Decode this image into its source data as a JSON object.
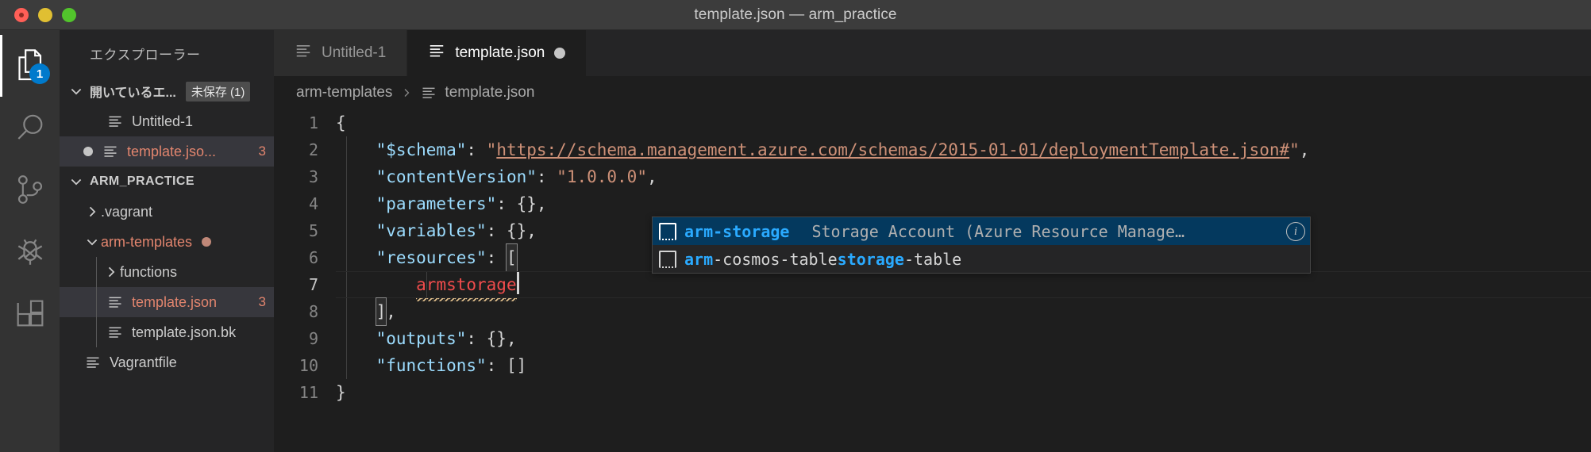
{
  "window": {
    "title": "template.json — arm_practice",
    "traffic_lights": [
      "close",
      "minimize",
      "zoom"
    ]
  },
  "activitybar": {
    "items": [
      {
        "name": "explorer",
        "icon": "files-icon",
        "active": true,
        "badge": "1"
      },
      {
        "name": "search",
        "icon": "search-icon",
        "active": false,
        "badge": ""
      },
      {
        "name": "source-control",
        "icon": "source-control-icon",
        "active": false,
        "badge": ""
      },
      {
        "name": "run-and-debug",
        "icon": "bug-icon",
        "active": false,
        "badge": ""
      },
      {
        "name": "extensions",
        "icon": "extensions-icon",
        "active": false,
        "badge": ""
      }
    ]
  },
  "sidebar": {
    "title": "エクスプローラー",
    "open_editors": {
      "header": "開いているエ...",
      "badge": "未保存 (1)",
      "items": [
        {
          "label": "Untitled-1",
          "icon": "json-file-icon",
          "dirty": false,
          "selected": false,
          "count": ""
        },
        {
          "label": "template.jso...",
          "icon": "json-file-icon",
          "dirty": true,
          "selected": true,
          "count": "3"
        }
      ]
    },
    "folder": {
      "header": "ARM_PRACTICE",
      "tree": [
        {
          "label": ".vagrant",
          "type": "folder",
          "expanded": false,
          "depth": 1,
          "modified": false,
          "count": "",
          "selected": false
        },
        {
          "label": "arm-templates",
          "type": "folder",
          "expanded": true,
          "depth": 1,
          "modified": true,
          "count": "",
          "selected": false,
          "dot": true
        },
        {
          "label": "functions",
          "type": "folder",
          "expanded": false,
          "depth": 2,
          "modified": false,
          "count": "",
          "selected": false
        },
        {
          "label": "template.json",
          "type": "file",
          "depth": 2,
          "modified": true,
          "count": "3",
          "selected": true
        },
        {
          "label": "template.json.bk",
          "type": "file",
          "depth": 2,
          "modified": false,
          "count": "",
          "selected": false
        },
        {
          "label": "Vagrantfile",
          "type": "file",
          "depth": 1,
          "modified": false,
          "count": "",
          "selected": false
        }
      ]
    }
  },
  "tabs": [
    {
      "label": "Untitled-1",
      "icon": "json-file-icon",
      "active": false,
      "dirty": false
    },
    {
      "label": "template.json",
      "icon": "json-file-icon",
      "active": true,
      "dirty": true
    }
  ],
  "breadcrumb": {
    "folder": "arm-templates",
    "separator": "›",
    "file": "template.json",
    "file_icon": "json-file-icon"
  },
  "editor": {
    "language": "json",
    "line_numbers": [
      "1",
      "2",
      "3",
      "4",
      "5",
      "6",
      "7",
      "8",
      "9",
      "10",
      "11"
    ],
    "current_line": 7,
    "lines": [
      {
        "n": "1",
        "tokens": [
          {
            "t": "{",
            "c": "p"
          }
        ]
      },
      {
        "n": "2",
        "tokens": [
          {
            "t": "    ",
            "c": "p"
          },
          {
            "t": "\"$schema\"",
            "c": "k"
          },
          {
            "t": ": ",
            "c": "p"
          },
          {
            "t": "\"",
            "c": "s"
          },
          {
            "t": "https://schema.management.azure.com/schemas/2015-01-01/deploymentTemplate.json#",
            "c": "lnk"
          },
          {
            "t": "\"",
            "c": "s"
          },
          {
            "t": ",",
            "c": "p"
          }
        ]
      },
      {
        "n": "3",
        "tokens": [
          {
            "t": "    ",
            "c": "p"
          },
          {
            "t": "\"contentVersion\"",
            "c": "k"
          },
          {
            "t": ": ",
            "c": "p"
          },
          {
            "t": "\"1.0.0.0\"",
            "c": "s"
          },
          {
            "t": ",",
            "c": "p"
          }
        ]
      },
      {
        "n": "4",
        "tokens": [
          {
            "t": "    ",
            "c": "p"
          },
          {
            "t": "\"parameters\"",
            "c": "k"
          },
          {
            "t": ": {},",
            "c": "p"
          }
        ]
      },
      {
        "n": "5",
        "tokens": [
          {
            "t": "    ",
            "c": "p"
          },
          {
            "t": "\"variables\"",
            "c": "k"
          },
          {
            "t": ": {},",
            "c": "p"
          }
        ]
      },
      {
        "n": "6",
        "tokens": [
          {
            "t": "    ",
            "c": "p"
          },
          {
            "t": "\"resources\"",
            "c": "k"
          },
          {
            "t": ": ",
            "c": "p"
          },
          {
            "t": "[",
            "c": "bracketmatch"
          }
        ]
      },
      {
        "n": "7",
        "tokens": [
          {
            "t": "        ",
            "c": "p"
          },
          {
            "t": "armstorage",
            "c": "err squiggle"
          }
        ]
      },
      {
        "n": "8",
        "tokens": [
          {
            "t": "    ",
            "c": "p"
          },
          {
            "t": "]",
            "c": "bracketmatch"
          },
          {
            "t": ",",
            "c": "p"
          }
        ]
      },
      {
        "n": "9",
        "tokens": [
          {
            "t": "    ",
            "c": "p"
          },
          {
            "t": "\"outputs\"",
            "c": "k"
          },
          {
            "t": ": {},",
            "c": "p"
          }
        ]
      },
      {
        "n": "10",
        "tokens": [
          {
            "t": "    ",
            "c": "p"
          },
          {
            "t": "\"functions\"",
            "c": "k"
          },
          {
            "t": ": []",
            "c": "p"
          }
        ]
      },
      {
        "n": "11",
        "tokens": [
          {
            "t": "}",
            "c": "p"
          }
        ]
      }
    ],
    "raw_text": "{\n    \"$schema\": \"https://schema.management.azure.com/schemas/2015-01-01/deploymentTemplate.json#\",\n    \"contentVersion\": \"1.0.0.0\",\n    \"parameters\": {},\n    \"variables\": {},\n    \"resources\": [\n        armstorage\n    ],\n    \"outputs\": {},\n    \"functions\": []\n}"
  },
  "suggest_widget": {
    "items": [
      {
        "icon": "snippet-icon",
        "label_pre": "arm",
        "label_match": "-storage",
        "label_post": "",
        "detail": "Storage Account (Azure Resource Manage…",
        "info_icon": "info-icon",
        "focused": true
      },
      {
        "icon": "snippet-icon",
        "label_pre": "arm",
        "label_mid": "-cosmos-table",
        "label_match": "storage",
        "label_post": "-table",
        "detail": "",
        "info_icon": "",
        "focused": false
      }
    ]
  },
  "colors": {
    "titlebar": "#3c3c3c",
    "activitybar": "#333333",
    "sidebar": "#252526",
    "editor": "#1e1e1e",
    "accent_blue": "#007acc",
    "suggest_focus": "#04395e",
    "string": "#ce9178",
    "key": "#9cdcfe",
    "error": "#f14c4c",
    "warning_squiggle": "#e2c08d",
    "modified_file": "#e2856e"
  }
}
